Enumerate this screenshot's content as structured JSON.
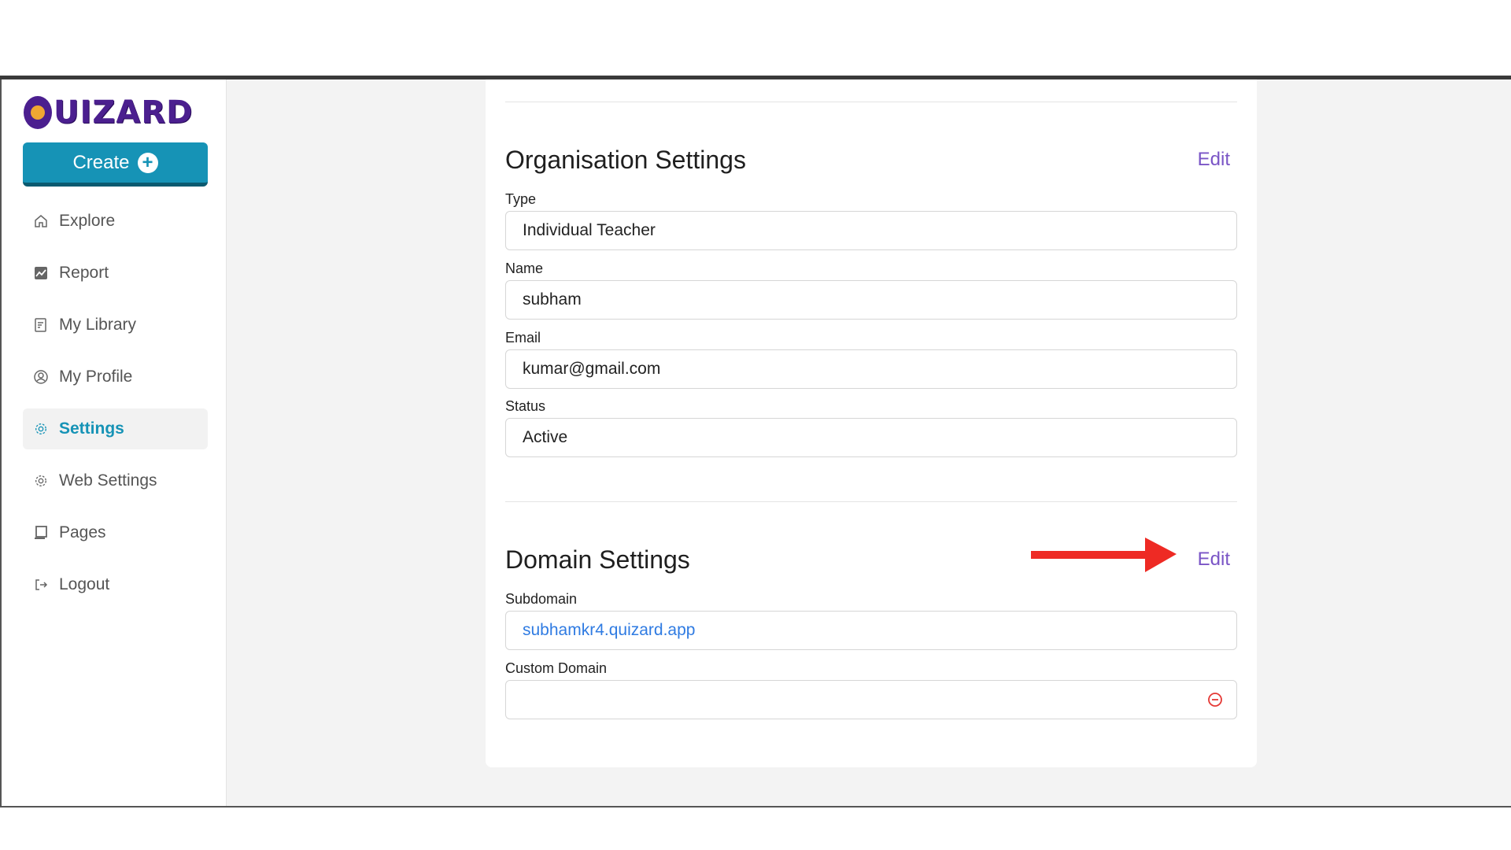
{
  "brand": {
    "logo_text": "UIZARD"
  },
  "sidebar": {
    "create_label": "Create",
    "items": [
      {
        "label": "Explore",
        "icon": "home-icon"
      },
      {
        "label": "Report",
        "icon": "chart-icon"
      },
      {
        "label": "My Library",
        "icon": "library-icon"
      },
      {
        "label": "My Profile",
        "icon": "profile-icon"
      },
      {
        "label": "Settings",
        "icon": "gear-icon",
        "active": true
      },
      {
        "label": "Web Settings",
        "icon": "gear-icon"
      },
      {
        "label": "Pages",
        "icon": "pages-icon"
      },
      {
        "label": "Logout",
        "icon": "logout-icon"
      }
    ]
  },
  "organisation": {
    "title": "Organisation Settings",
    "edit_label": "Edit",
    "fields": [
      {
        "label": "Type",
        "value": "Individual Teacher"
      },
      {
        "label": "Name",
        "value": "subham"
      },
      {
        "label": "Email",
        "value": "kumar@gmail.com"
      },
      {
        "label": "Status",
        "value": "Active"
      }
    ]
  },
  "domain": {
    "title": "Domain Settings",
    "edit_label": "Edit",
    "subdomain_label": "Subdomain",
    "subdomain_value": "subhamkr4.quizard.app",
    "custom_label": "Custom Domain",
    "custom_value": ""
  },
  "colors": {
    "accent": "#1693b6",
    "edit": "#7a55c6",
    "link": "#2f7be2",
    "clear": "#e53935",
    "arrow": "#ee2a24"
  }
}
